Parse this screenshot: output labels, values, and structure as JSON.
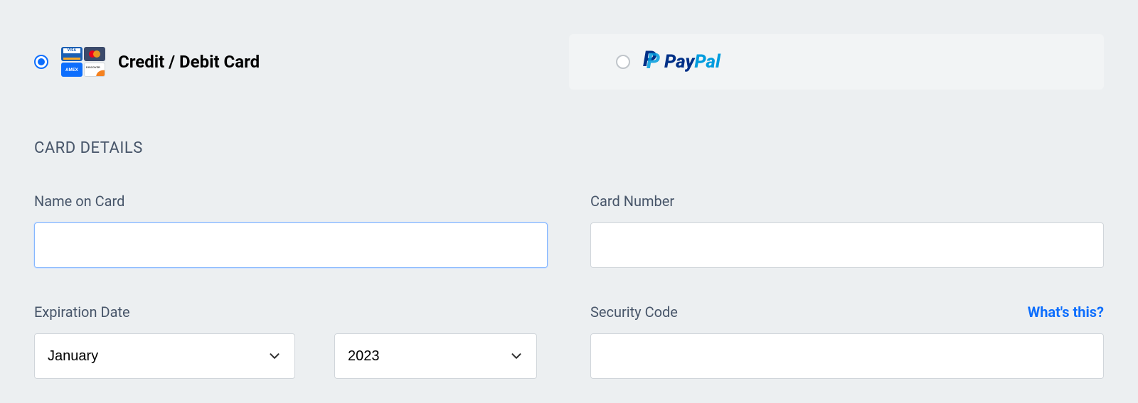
{
  "payment_methods": {
    "card": {
      "label": "Credit / Debit Card",
      "selected": true,
      "icons": [
        "visa-icon",
        "mastercard-icon",
        "amex-icon",
        "discover-icon"
      ]
    },
    "paypal": {
      "brand_pay": "Pay",
      "brand_pal": "Pal",
      "selected": false
    }
  },
  "section_title": "CARD DETAILS",
  "fields": {
    "name_on_card": {
      "label": "Name on Card",
      "value": ""
    },
    "card_number": {
      "label": "Card Number",
      "value": ""
    },
    "expiration": {
      "label": "Expiration Date",
      "month": {
        "selected": "January"
      },
      "year": {
        "selected": "2023"
      }
    },
    "security_code": {
      "label": "Security Code",
      "help_text": "What's this?",
      "value": ""
    }
  }
}
